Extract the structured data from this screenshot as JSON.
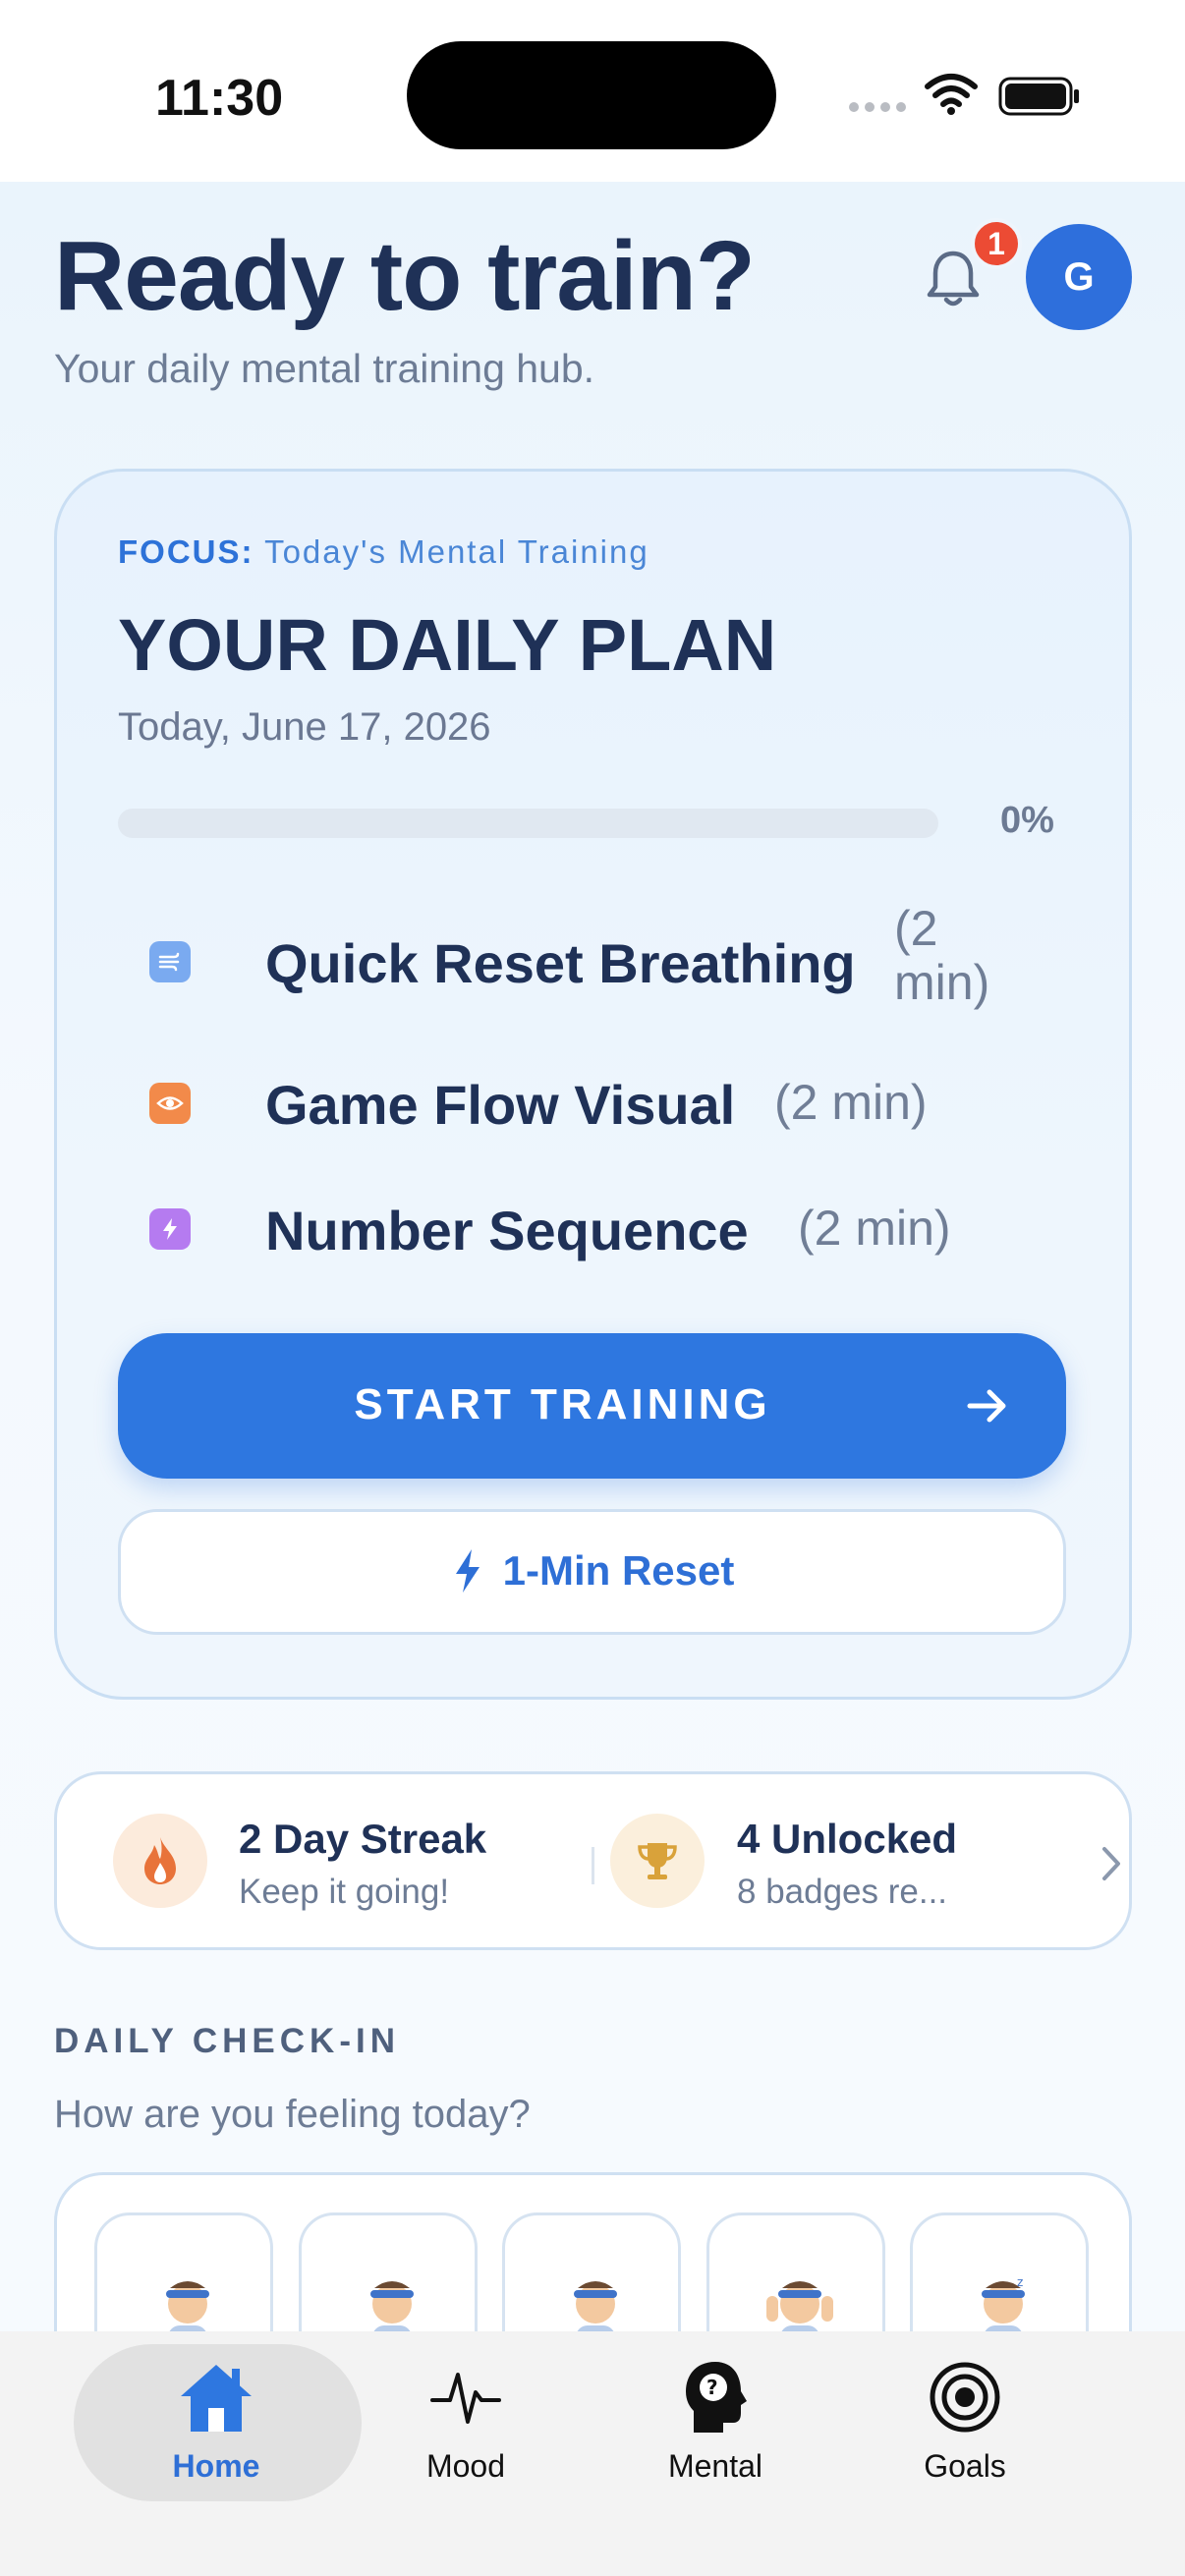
{
  "status_bar": {
    "time": "11:30"
  },
  "header": {
    "title": "Ready to train?",
    "subtitle": "Your daily mental training hub.",
    "notification_count": "1",
    "avatar_initial": "G"
  },
  "plan": {
    "focus_label": "FOCUS:",
    "focus_value": "Today's Mental Training",
    "title": "YOUR DAILY PLAN",
    "date": "Today, June 17, 2026",
    "progress_fraction": 0,
    "progress_text": "0%",
    "exercises": [
      {
        "name": "Quick Reset Breathing",
        "duration_line1": "(2",
        "duration_line2": "min)",
        "icon": "wind-icon",
        "color": "#6fa3ea"
      },
      {
        "name": "Game Flow Visual",
        "duration": "(2 min)",
        "icon": "eye-icon",
        "color": "#f28a4a"
      },
      {
        "name": "Number Sequence",
        "duration": "(2 min)",
        "icon": "bolt-icon",
        "color": "#b57bf0"
      }
    ],
    "start_label": "START TRAINING",
    "reset_label": "1-Min Reset"
  },
  "stats": {
    "streak_title": "2 Day Streak",
    "streak_sub": "Keep it going!",
    "badges_title": "4 Unlocked",
    "badges_sub": "8 badges re..."
  },
  "checkin": {
    "section_label": "DAILY CHECK-IN",
    "question": "How are you feeling today?"
  },
  "tabs": [
    {
      "label": "Home",
      "icon": "home-icon",
      "active": true
    },
    {
      "label": "Mood",
      "icon": "pulse-icon",
      "active": false
    },
    {
      "label": "Mental",
      "icon": "brain-head-icon",
      "active": false
    },
    {
      "label": "Goals",
      "icon": "target-icon",
      "active": false
    }
  ],
  "colors": {
    "accent": "#2e77e0",
    "title": "#1f3157",
    "muted": "#6d7c95",
    "badge": "#ec4b34"
  }
}
